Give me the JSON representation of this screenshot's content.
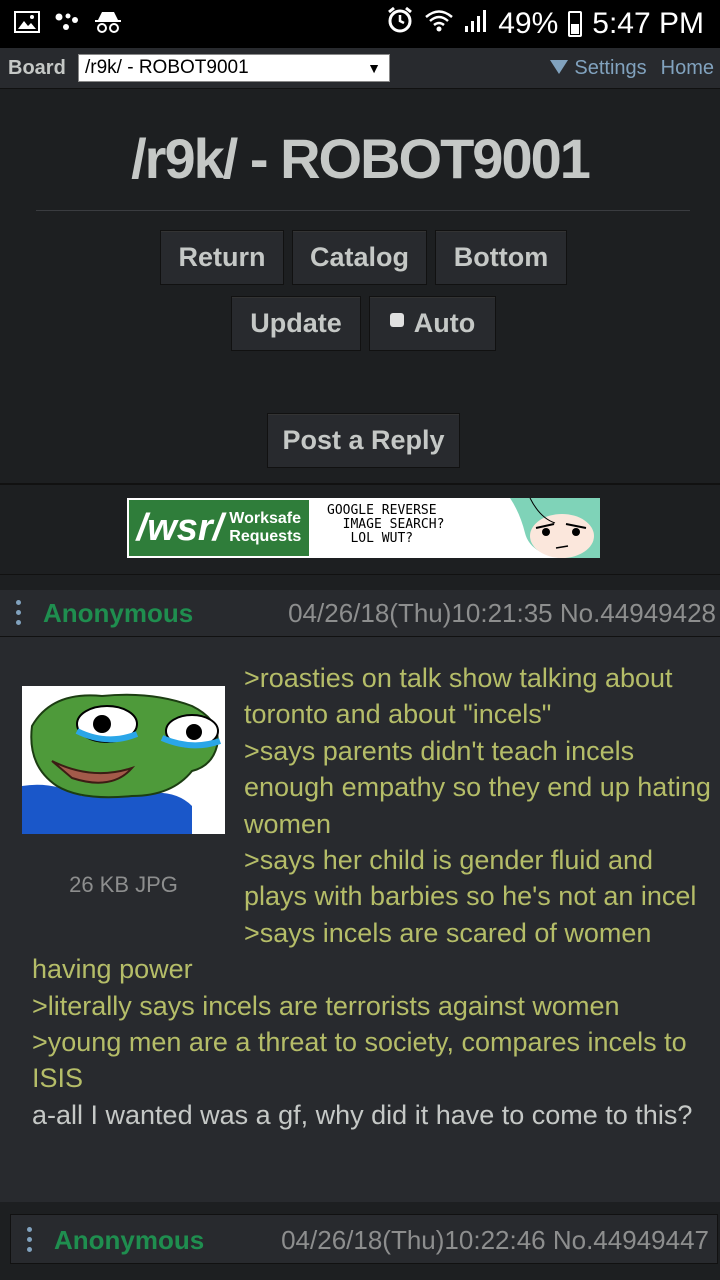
{
  "statusbar": {
    "battery": "49%",
    "time": "5:47 PM"
  },
  "boardbar": {
    "label": "Board",
    "selected": "/r9k/ - ROBOT9001",
    "settings": "Settings",
    "home": "Home"
  },
  "header": {
    "title": "/r9k/ - ROBOT9001",
    "buttons": {
      "return": "Return",
      "catalog": "Catalog",
      "bottom": "Bottom",
      "update": "Update",
      "auto": "Auto",
      "post_reply": "Post a Reply"
    }
  },
  "banner": {
    "wsr": "/wsr/",
    "worksafe": "Worksafe",
    "requests": "Requests",
    "line1": "GOOGLE REVERSE",
    "line2": "IMAGE SEARCH?",
    "line3": "LOL WUT?"
  },
  "posts": [
    {
      "name": "Anonymous",
      "meta": "04/26/18(Thu)10:21:35 No.44949428",
      "file": "26 KB JPG",
      "lines": [
        ">roasties on talk show talking about toronto and about \"incels\"",
        ">says parents didn't teach incels enough empathy so they end up hating women",
        ">says her child is gender fluid and plays with barbies so he's not an incel",
        ">says incels are scared of women having power",
        ">literally says incels are terrorists against women",
        ">young men are a threat to society, compares incels to ISIS",
        "a-all I wanted was a gf, why did it have to come to this?"
      ]
    },
    {
      "name": "Anonymous",
      "meta": "04/26/18(Thu)10:22:46 No.44949447"
    }
  ],
  "colors": {
    "greentext": "#b5bd68",
    "name": "#1f8e4f",
    "link": "#81a2be",
    "bg": "#1d1f21",
    "post_bg": "#282a2e"
  }
}
